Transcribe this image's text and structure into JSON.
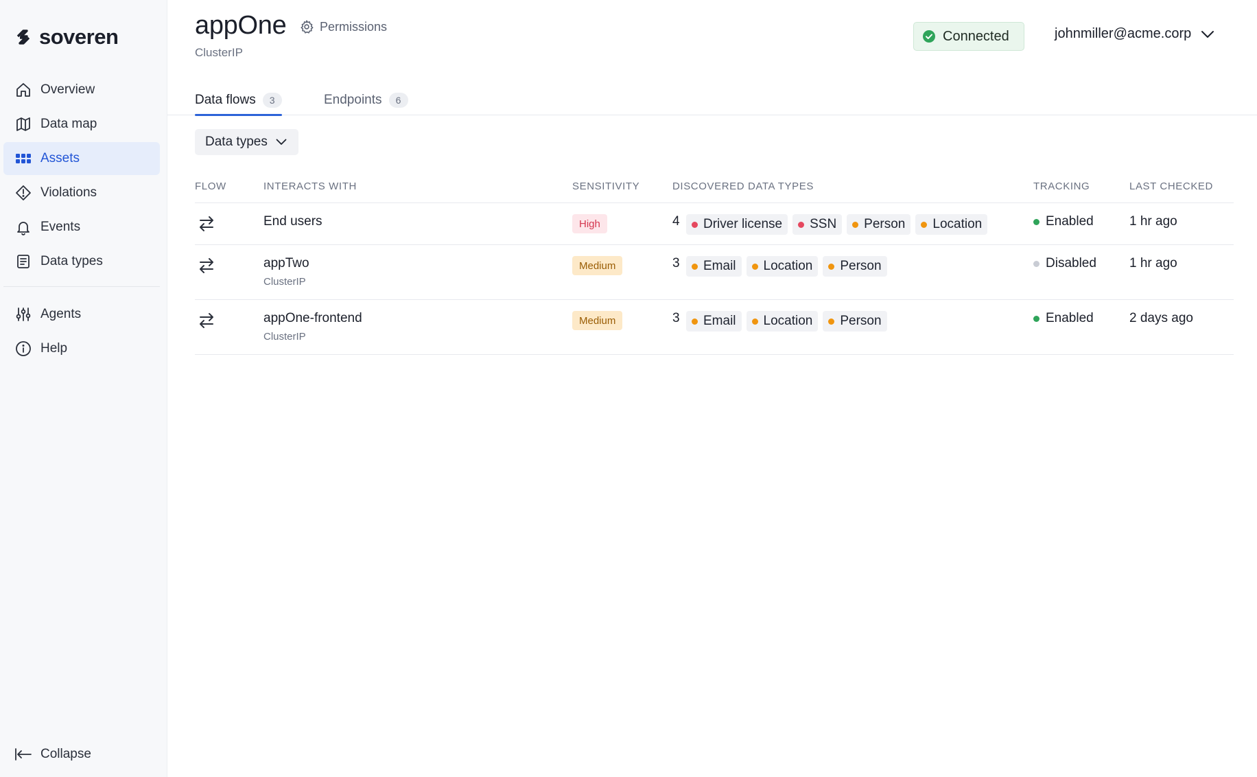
{
  "brand": {
    "name": "soveren"
  },
  "sidebar": {
    "items": [
      {
        "label": "Overview",
        "icon": "home-icon"
      },
      {
        "label": "Data map",
        "icon": "map-icon"
      },
      {
        "label": "Assets",
        "icon": "grid-icon",
        "active": true
      },
      {
        "label": "Violations",
        "icon": "alert-diamond-icon"
      },
      {
        "label": "Events",
        "icon": "bell-icon"
      },
      {
        "label": "Data types",
        "icon": "document-list-icon"
      }
    ],
    "secondary_items": [
      {
        "label": "Agents",
        "icon": "sliders-icon"
      },
      {
        "label": "Help",
        "icon": "info-icon"
      }
    ],
    "collapse_label": "Collapse"
  },
  "header": {
    "title": "appOne",
    "permissions_label": "Permissions",
    "subtitle": "ClusterIP",
    "status": "Connected",
    "user_email": "johnmiller@acme.corp"
  },
  "tabs": [
    {
      "label": "Data flows",
      "count": "3",
      "active": true
    },
    {
      "label": "Endpoints",
      "count": "6",
      "active": false
    }
  ],
  "filter": {
    "label": "Data types"
  },
  "table": {
    "columns": {
      "flow": "FLOW",
      "interacts_with": "INTERACTS WITH",
      "sensitivity": "SENSITIVITY",
      "discovered": "DISCOVERED DATA TYPES",
      "tracking": "TRACKING",
      "last_checked": "LAST CHECKED"
    },
    "rows": [
      {
        "name": "End users",
        "sub": "",
        "sensitivity": "High",
        "count": "4",
        "types": [
          {
            "label": "Driver license",
            "level": "high"
          },
          {
            "label": "SSN",
            "level": "high"
          },
          {
            "label": "Person",
            "level": "medium"
          },
          {
            "label": "Location",
            "level": "medium"
          }
        ],
        "tracking": "Enabled",
        "last_checked": "1 hr ago"
      },
      {
        "name": "appTwo",
        "sub": "ClusterIP",
        "sensitivity": "Medium",
        "count": "3",
        "types": [
          {
            "label": "Email",
            "level": "medium"
          },
          {
            "label": "Location",
            "level": "medium"
          },
          {
            "label": "Person",
            "level": "medium"
          }
        ],
        "tracking": "Disabled",
        "last_checked": "1 hr ago"
      },
      {
        "name": "appOne-frontend",
        "sub": "ClusterIP",
        "sensitivity": "Medium",
        "count": "3",
        "types": [
          {
            "label": "Email",
            "level": "medium"
          },
          {
            "label": "Location",
            "level": "medium"
          },
          {
            "label": "Person",
            "level": "medium"
          }
        ],
        "tracking": "Enabled",
        "last_checked": "2 days ago"
      }
    ]
  },
  "colors": {
    "accent": "#2d63d8",
    "high": "#e5485f",
    "medium": "#f0950f",
    "enabled": "#2fa45a",
    "disabled": "#c9ccd4"
  }
}
